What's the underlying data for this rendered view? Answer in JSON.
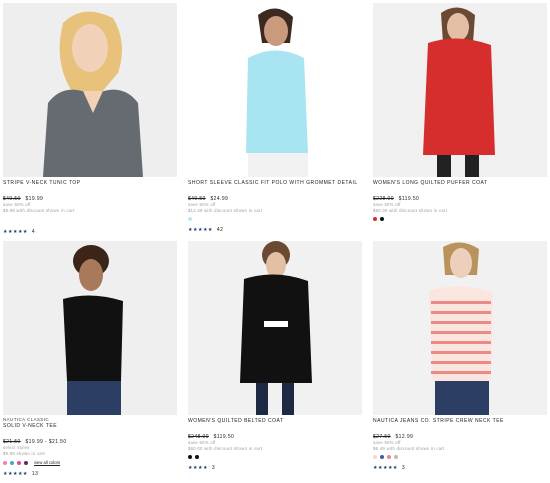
{
  "products": [
    {
      "brand": "",
      "name": "STRIPE V-NECK TUNIC TOP",
      "was": "$49.50",
      "price": "$19.99",
      "save": "save 60% off",
      "discount": "$9.99 with discount shown in cart",
      "swatches": [],
      "view_all": "",
      "stars": "★★★★★",
      "reviews": "4"
    },
    {
      "brand": "",
      "name": "SHORT SLEEVE CLASSIC FIT POLO WITH GROMMET DETAIL",
      "was": "$49.50",
      "price": "$24.99",
      "save": "save 50% off",
      "discount": "$12.49 with discount shown in cart",
      "swatches": [
        "#bfe6f2"
      ],
      "view_all": "",
      "stars": "★★★★★",
      "reviews": "42"
    },
    {
      "brand": "",
      "name": "WOMEN'S LONG QUILTED PUFFER COAT",
      "was": "$228.00",
      "price": "$119.50",
      "save": "save 50% off",
      "discount": "$60.00 with discount shown in cart",
      "swatches": [
        "#d62d2d",
        "#111111"
      ],
      "view_all": "",
      "stars": "",
      "reviews": ""
    },
    {
      "brand": "NAUTICA CLASSIC",
      "name": "SOLID V-NECK TEE",
      "was": "$21.50",
      "price": "$19.99 - $21.50",
      "save": "select styles",
      "discount": "$9.99 shown in cart",
      "swatches": [
        "#f07fb0",
        "#3bb0c9",
        "#e84a8a",
        "#5b2a6e"
      ],
      "view_all": "view all colors",
      "stars": "★★★★★",
      "reviews": "13"
    },
    {
      "brand": "",
      "name": "WOMEN'S QUILTED BELTED COAT",
      "was": "$248.00",
      "price": "$119.50",
      "save": "save 50% off",
      "discount": "$60.00 with discount shown in cart",
      "swatches": [
        "#111111",
        "#111111"
      ],
      "view_all": "",
      "stars": "★★★★",
      "reviews": "3"
    },
    {
      "brand": "",
      "name": "NAUTICA JEANS CO. STRIPE CREW NECK TEE",
      "was": "$27.50",
      "price": "$12.99",
      "save": "save 50% off",
      "discount": "$6.49 with discount shown in cart",
      "swatches": [
        "#f4d7d0",
        "#3a5ea8",
        "#f08a8a",
        "#bbbbbb"
      ],
      "view_all": "",
      "stars": "★★★★★",
      "reviews": "3"
    }
  ],
  "colors": {
    "rating_star": "#1d3b6e",
    "muted_text": "#9a9a9a",
    "image_bg": "#f1f1f1"
  },
  "icons": [
    "star-icon",
    "color-swatch"
  ]
}
